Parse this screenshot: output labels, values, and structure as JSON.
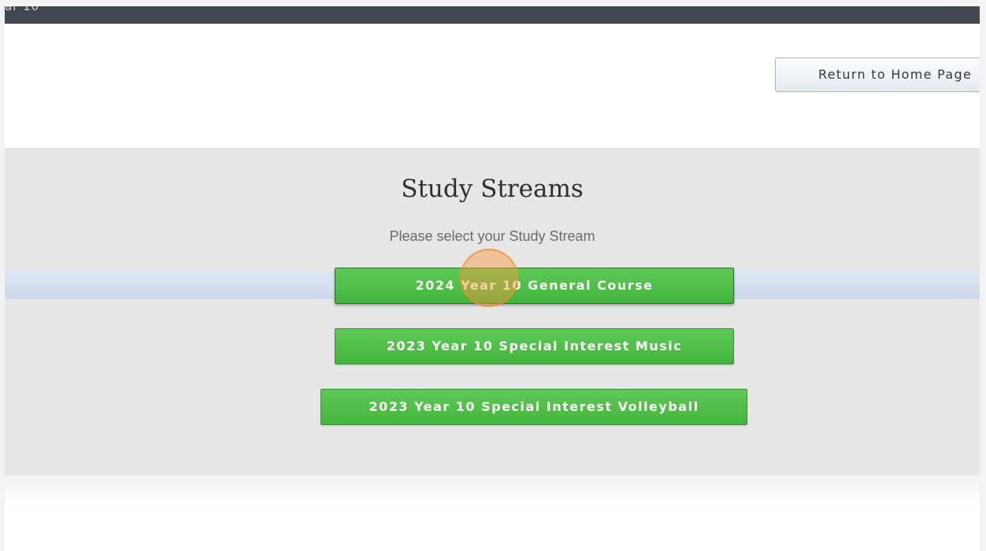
{
  "header": {
    "title": "ar 10"
  },
  "actions": {
    "return_home_label": "Return to Home Page"
  },
  "study_streams": {
    "heading": "Study Streams",
    "prompt": "Please select your Study Stream",
    "options": [
      {
        "label": "2024 Year 10 General Course",
        "state": "hovered"
      },
      {
        "label": "2023 Year 10 Special Interest Music"
      },
      {
        "label": "2023 Year 10 Special Interest Volleyball"
      }
    ]
  },
  "colors": {
    "topbar": "#44474f",
    "panel": "#e6e6e6",
    "button_green": "#4cbc44",
    "highlight_row": "#d6e1ef",
    "click_indicator": "#f39a3e"
  },
  "icons": {
    "click_indicator": "click-indicator-circle"
  }
}
